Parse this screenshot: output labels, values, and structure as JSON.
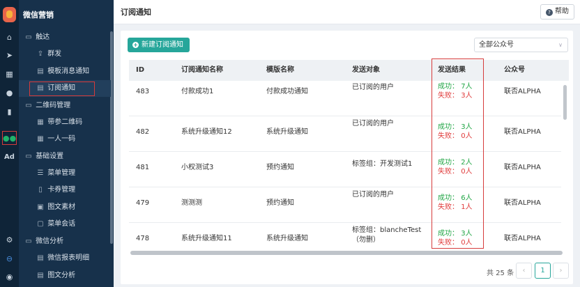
{
  "rail": {
    "icons": [
      "home-icon",
      "send-icon",
      "layout-icon",
      "user-icon",
      "bar-chart-icon",
      "wechat-icon",
      "ad-icon",
      "settings-icon",
      "minus-circle-icon",
      "avatar-icon"
    ],
    "ad_label": "Ad"
  },
  "sidebar": {
    "brand": "微信营销",
    "groups": [
      {
        "label": "触达",
        "items": [
          "群发",
          "模板消息通知",
          "订阅通知"
        ]
      },
      {
        "label": "二维码管理",
        "items": [
          "带参二维码",
          "一人一码"
        ]
      },
      {
        "label": "基础设置",
        "items": [
          "菜单管理",
          "卡券管理",
          "图文素材",
          "菜单会话"
        ]
      },
      {
        "label": "微信分析",
        "items": [
          "微信报表明细",
          "图文分析"
        ]
      }
    ],
    "active_item": "订阅通知"
  },
  "header": {
    "title": "订阅通知",
    "help_label": "帮助"
  },
  "toolbar": {
    "new_button": "新建订阅通知",
    "account_select": "全部公众号"
  },
  "table": {
    "columns": [
      "ID",
      "订阅通知名称",
      "模版名称",
      "发送对象",
      "发送结果",
      "公众号"
    ],
    "success_prefix": "成功：",
    "fail_prefix": "失败：",
    "rows": [
      {
        "id": "483",
        "name": "付款成功1",
        "template": "付款成功通知",
        "target": [
          "已订阅的用户"
        ],
        "success": "7人",
        "fail": "3人",
        "account": "联否ALPHA"
      },
      {
        "id": "482",
        "name": "系统升级通知12",
        "template": "系统升级通知",
        "target": [
          "已订阅的用户"
        ],
        "success": "3人",
        "fail": "0人",
        "account": "联否ALPHA"
      },
      {
        "id": "481",
        "name": "小权测试3",
        "template": "预约通知",
        "target": [
          "标签组：开发测试1"
        ],
        "success": "2人",
        "fail": "0人",
        "account": "联否ALPHA"
      },
      {
        "id": "479",
        "name": "测测测",
        "template": "预约通知",
        "target": [
          "已订阅的用户"
        ],
        "success": "6人",
        "fail": "1人",
        "account": "联否ALPHA"
      },
      {
        "id": "478",
        "name": "系统升级通知11",
        "template": "系统升级通知",
        "target": [
          "标签组：blancheTest",
          "（勿删）"
        ],
        "success": "3人",
        "fail": "0人",
        "account": "联否ALPHA"
      }
    ]
  },
  "pagination": {
    "total": "共 25 条",
    "prev": "‹",
    "current": "1",
    "next": "›"
  },
  "colors": {
    "sidebar_bg": "#17314b",
    "rail_bg": "#0f2438",
    "accent": "#26a69a",
    "success": "#22a646",
    "fail": "#e03b3b",
    "highlight_box": "#d63b3b"
  }
}
